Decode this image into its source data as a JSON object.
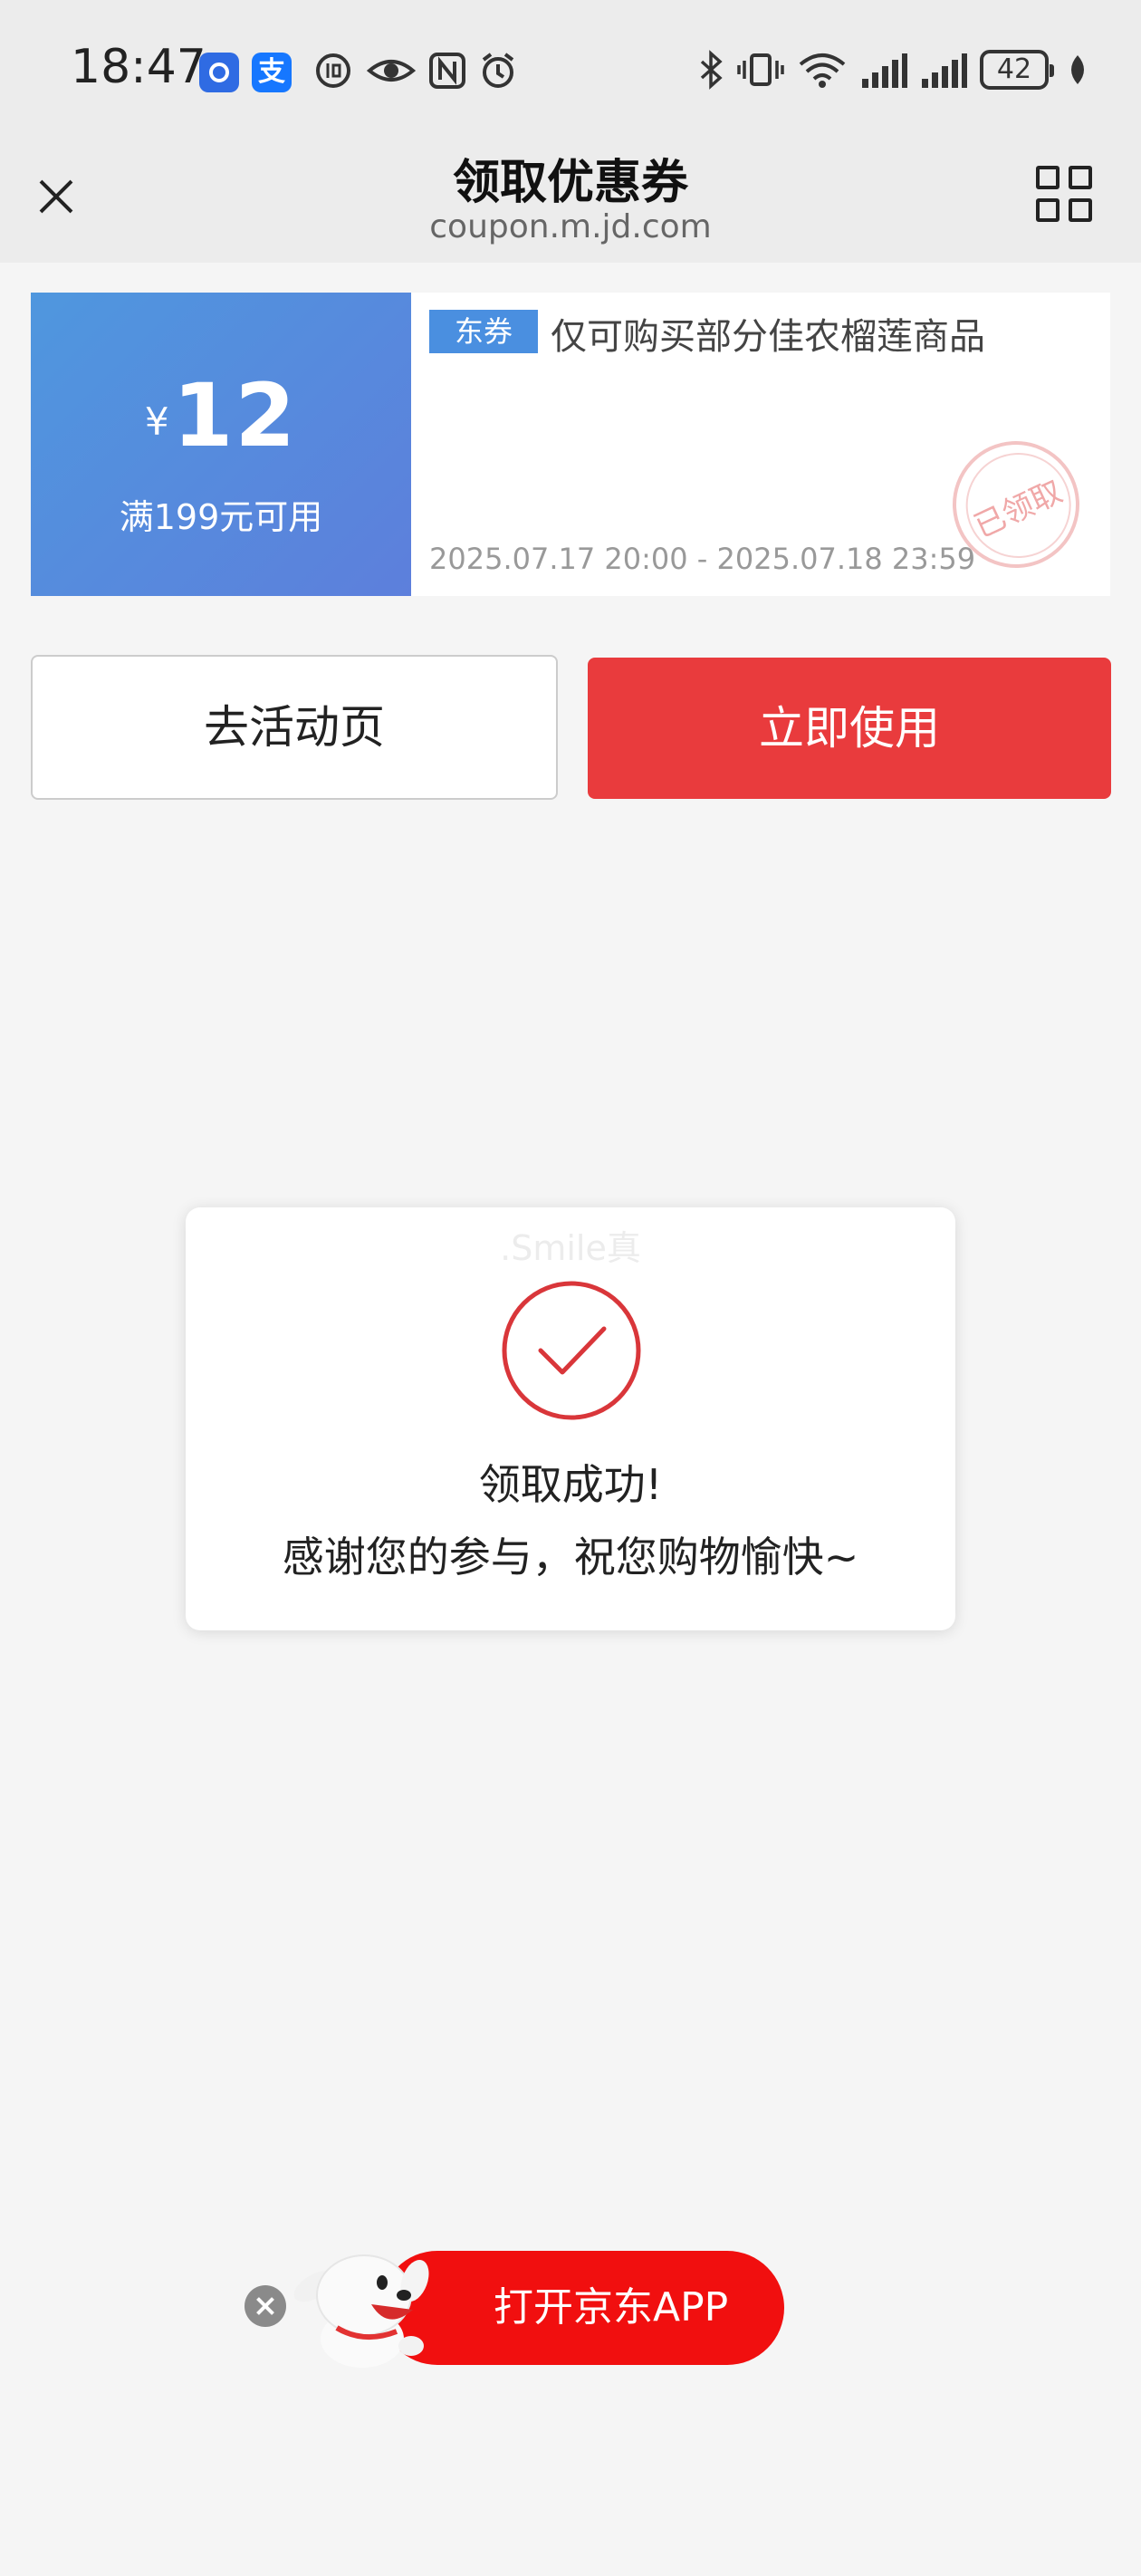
{
  "status_bar": {
    "time": "18:47",
    "battery": "42",
    "icons": [
      "app-blue-icon",
      "alipay-icon",
      "data-saver-icon",
      "eye-icon",
      "nfc-icon",
      "alarm-icon",
      "bluetooth-icon",
      "vibrate-icon",
      "wifi-icon",
      "signal-icon",
      "signal-icon",
      "battery-icon",
      "leaf-icon"
    ]
  },
  "header": {
    "title": "领取优惠券",
    "url": "coupon.m.jd.com",
    "close_icon": "close-icon",
    "menu_icon": "grid-icon"
  },
  "coupon": {
    "currency": "¥",
    "amount": "12",
    "condition": "满199元可用",
    "tag": "东券",
    "description": "仅可购买部分佳农榴莲商品",
    "validity": "2025.07.17 20:00 - 2025.07.18 23:59",
    "stamp": "已领取",
    "colors": {
      "left_panel": "#5a86dc",
      "tag": "#4a8fe0"
    }
  },
  "actions": {
    "activity_label": "去活动页",
    "use_label": "立即使用",
    "use_color": "#e93b3d"
  },
  "dialog": {
    "watermark": ".Smile真",
    "icon": "check-circle-icon",
    "title": "领取成功!",
    "message": "感谢您的参与，祝您购物愉快~"
  },
  "app_banner": {
    "label": "打开京东APP",
    "close_icon": "close-icon",
    "mascot_icon": "jd-dog-mascot-icon",
    "color": "#f10f0f"
  }
}
